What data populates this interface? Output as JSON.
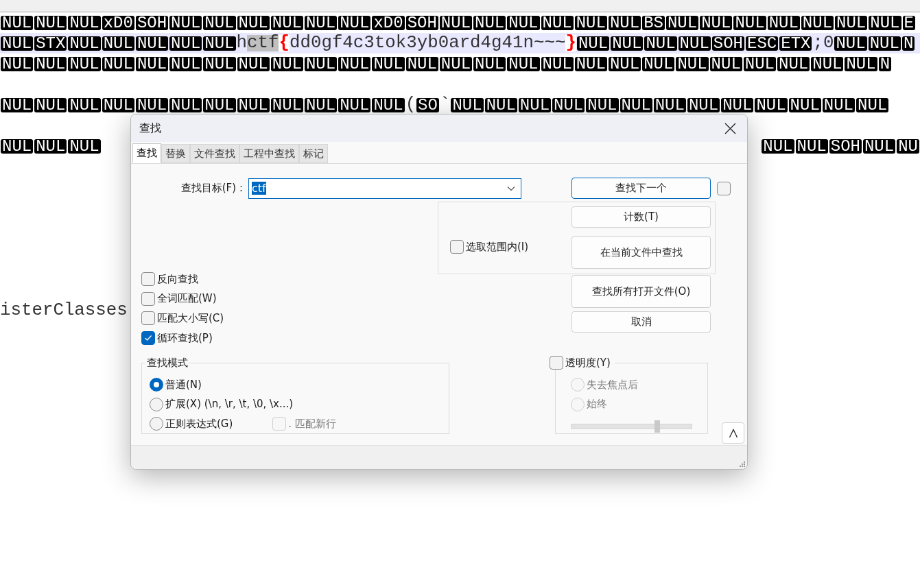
{
  "editor": {
    "lines": [
      {
        "kind": "full",
        "current": false,
        "segments": [
          {
            "kind": "ctrl",
            "text": "NUL"
          },
          {
            "kind": "ctrl",
            "text": "NUL"
          },
          {
            "kind": "ctrl",
            "text": "NUL"
          },
          {
            "kind": "ctrl",
            "text": "xD0"
          },
          {
            "kind": "ctrl",
            "text": "SOH"
          },
          {
            "kind": "ctrl",
            "text": "NUL"
          },
          {
            "kind": "ctrl",
            "text": "NUL"
          },
          {
            "kind": "ctrl",
            "text": "NUL"
          },
          {
            "kind": "ctrl",
            "text": "NUL"
          },
          {
            "kind": "ctrl",
            "text": "NUL"
          },
          {
            "kind": "ctrl",
            "text": "NUL"
          },
          {
            "kind": "ctrl",
            "text": "xD0"
          },
          {
            "kind": "ctrl",
            "text": "SOH"
          },
          {
            "kind": "ctrl",
            "text": "NUL"
          },
          {
            "kind": "ctrl",
            "text": "NUL"
          },
          {
            "kind": "ctrl",
            "text": "NUL"
          },
          {
            "kind": "ctrl",
            "text": "NUL"
          },
          {
            "kind": "ctrl",
            "text": "NUL"
          },
          {
            "kind": "ctrl",
            "text": "NUL"
          },
          {
            "kind": "ctrl",
            "text": "BS"
          },
          {
            "kind": "ctrl",
            "text": "NUL"
          },
          {
            "kind": "ctrl",
            "text": "NUL"
          },
          {
            "kind": "ctrl",
            "text": "NUL"
          },
          {
            "kind": "ctrl",
            "text": "NUL"
          },
          {
            "kind": "ctrl",
            "text": "NUL"
          },
          {
            "kind": "ctrl",
            "text": "NUL"
          },
          {
            "kind": "ctrl",
            "text": "NUL"
          },
          {
            "kind": "ctrl",
            "text": "E"
          }
        ]
      },
      {
        "kind": "full",
        "current": true,
        "segments": [
          {
            "kind": "ctrl",
            "text": "NUL"
          },
          {
            "kind": "ctrl",
            "text": "STX"
          },
          {
            "kind": "ctrl",
            "text": "NUL"
          },
          {
            "kind": "ctrl",
            "text": "NUL"
          },
          {
            "kind": "ctrl",
            "text": "NUL"
          },
          {
            "kind": "ctrl",
            "text": "NUL"
          },
          {
            "kind": "ctrl",
            "text": "NUL"
          },
          {
            "kind": "text",
            "text": "h"
          },
          {
            "kind": "match",
            "text": "ctf"
          },
          {
            "kind": "brace",
            "text": "{"
          },
          {
            "kind": "text",
            "text": "dd0gf4c3tok3yb0ard4g41n~~~"
          },
          {
            "kind": "brace",
            "text": "}"
          },
          {
            "kind": "ctrl",
            "text": "NUL"
          },
          {
            "kind": "ctrl",
            "text": "NUL"
          },
          {
            "kind": "ctrl",
            "text": "NUL"
          },
          {
            "kind": "ctrl",
            "text": "NUL"
          },
          {
            "kind": "ctrl",
            "text": "SOH"
          },
          {
            "kind": "ctrl",
            "text": "ESC"
          },
          {
            "kind": "ctrl",
            "text": "ETX"
          },
          {
            "kind": "text",
            "text": ";0"
          },
          {
            "kind": "ctrl",
            "text": "NUL"
          },
          {
            "kind": "ctrl",
            "text": "NUL"
          },
          {
            "kind": "ctrl",
            "text": "N"
          }
        ]
      },
      {
        "kind": "full",
        "current": false,
        "segments": [
          {
            "kind": "ctrl",
            "text": "NUL"
          },
          {
            "kind": "ctrl",
            "text": "NUL"
          },
          {
            "kind": "ctrl",
            "text": "NUL"
          },
          {
            "kind": "ctrl",
            "text": "NUL"
          },
          {
            "kind": "ctrl",
            "text": "NUL"
          },
          {
            "kind": "ctrl",
            "text": "NUL"
          },
          {
            "kind": "ctrl",
            "text": "NUL"
          },
          {
            "kind": "ctrl",
            "text": "NUL"
          },
          {
            "kind": "ctrl",
            "text": "NUL"
          },
          {
            "kind": "ctrl",
            "text": "NUL"
          },
          {
            "kind": "ctrl",
            "text": "NUL"
          },
          {
            "kind": "ctrl",
            "text": "NUL"
          },
          {
            "kind": "ctrl",
            "text": "NUL"
          },
          {
            "kind": "ctrl",
            "text": "NUL"
          },
          {
            "kind": "ctrl",
            "text": "NUL"
          },
          {
            "kind": "ctrl",
            "text": "NUL"
          },
          {
            "kind": "ctrl",
            "text": "NUL"
          },
          {
            "kind": "ctrl",
            "text": "NUL"
          },
          {
            "kind": "ctrl",
            "text": "NUL"
          },
          {
            "kind": "ctrl",
            "text": "NUL"
          },
          {
            "kind": "ctrl",
            "text": "NUL"
          },
          {
            "kind": "ctrl",
            "text": "NUL"
          },
          {
            "kind": "ctrl",
            "text": "NUL"
          },
          {
            "kind": "ctrl",
            "text": "NUL"
          },
          {
            "kind": "ctrl",
            "text": "NUL"
          },
          {
            "kind": "ctrl",
            "text": "NUL"
          },
          {
            "kind": "ctrl",
            "text": "N"
          }
        ]
      },
      {
        "kind": "blank"
      },
      {
        "kind": "full",
        "current": false,
        "segments": [
          {
            "kind": "ctrl",
            "text": "NUL"
          },
          {
            "kind": "ctrl",
            "text": "NUL"
          },
          {
            "kind": "ctrl",
            "text": "NUL"
          },
          {
            "kind": "ctrl",
            "text": "NUL"
          },
          {
            "kind": "ctrl",
            "text": "NUL"
          },
          {
            "kind": "ctrl",
            "text": "NUL"
          },
          {
            "kind": "ctrl",
            "text": "NUL"
          },
          {
            "kind": "ctrl",
            "text": "NUL"
          },
          {
            "kind": "ctrl",
            "text": "NUL"
          },
          {
            "kind": "ctrl",
            "text": "NUL"
          },
          {
            "kind": "ctrl",
            "text": "NUL"
          },
          {
            "kind": "ctrl",
            "text": "NUL"
          },
          {
            "kind": "text",
            "text": "("
          },
          {
            "kind": "ctrl",
            "text": "SO"
          },
          {
            "kind": "text",
            "text": "`"
          },
          {
            "kind": "ctrl",
            "text": "NUL"
          },
          {
            "kind": "ctrl",
            "text": "NUL"
          },
          {
            "kind": "ctrl",
            "text": "NUL"
          },
          {
            "kind": "ctrl",
            "text": "NUL"
          },
          {
            "kind": "ctrl",
            "text": "NUL"
          },
          {
            "kind": "ctrl",
            "text": "NUL"
          },
          {
            "kind": "ctrl",
            "text": "NUL"
          },
          {
            "kind": "ctrl",
            "text": "NUL"
          },
          {
            "kind": "ctrl",
            "text": "NUL"
          },
          {
            "kind": "ctrl",
            "text": "NUL"
          },
          {
            "kind": "ctrl",
            "text": "NUL"
          },
          {
            "kind": "ctrl",
            "text": "NUL"
          },
          {
            "kind": "ctrl",
            "text": "NUL"
          }
        ]
      },
      {
        "kind": "blank"
      },
      {
        "kind": "split",
        "left": [
          {
            "kind": "ctrl",
            "text": "NUL"
          },
          {
            "kind": "ctrl",
            "text": "NUL"
          },
          {
            "kind": "ctrl",
            "text": "NUL"
          }
        ],
        "right": [
          {
            "kind": "ctrl",
            "text": "NUL"
          },
          {
            "kind": "ctrl",
            "text": "NUL"
          },
          {
            "kind": "ctrl",
            "text": "SOH"
          },
          {
            "kind": "ctrl",
            "text": "NUL"
          },
          {
            "kind": "ctrl",
            "text": "NU"
          }
        ]
      },
      {
        "kind": "blank"
      },
      {
        "kind": "blank"
      },
      {
        "kind": "blank"
      },
      {
        "kind": "blank"
      },
      {
        "kind": "blank"
      },
      {
        "kind": "blank"
      },
      {
        "kind": "blank"
      },
      {
        "kind": "full",
        "current": false,
        "segments": [
          {
            "kind": "text",
            "text": "isterClasses"
          }
        ]
      }
    ]
  },
  "dialog": {
    "title": "查找",
    "tabs": [
      {
        "label": "查找",
        "selected": true
      },
      {
        "label": "替换",
        "selected": false
      },
      {
        "label": "文件查找",
        "selected": false
      },
      {
        "label": "工程中查找",
        "selected": false
      },
      {
        "label": "标记",
        "selected": false
      }
    ],
    "find_field": {
      "label": "查找目标(F)：",
      "value": "ctf"
    },
    "find_next_button": "查找下一个",
    "side_checkbox": {
      "checked": false
    },
    "in_selection": {
      "label": "选取范围内(I)",
      "checked": false
    },
    "count_button": "计数(T)",
    "find_in_current_button": "在当前文件中查找",
    "find_all_open_button": "查找所有打开文件(O)",
    "cancel_button": "取消",
    "options": [
      {
        "label": "反向查找",
        "checked": false
      },
      {
        "label": "全词匹配(W)",
        "checked": false
      },
      {
        "label": "匹配大小写(C)",
        "checked": false
      },
      {
        "label": "循环查找(P)",
        "checked": true
      }
    ],
    "search_mode": {
      "title": "查找模式",
      "modes": [
        {
          "label": "普通(N)",
          "selected": true
        },
        {
          "label": "扩展(X) (\\n, \\r, \\t, \\0, \\x...)",
          "selected": false
        },
        {
          "label": "正则表达式(G)",
          "selected": false
        }
      ],
      "dot_newline": {
        "label": ". 匹配新行",
        "checked": false,
        "disabled": true
      }
    },
    "transparency": {
      "label": "透明度(Y)",
      "checked": false,
      "modes": [
        {
          "label": "失去焦点后",
          "selected": false
        },
        {
          "label": "始终",
          "selected": false
        }
      ],
      "level": 0.71
    }
  }
}
